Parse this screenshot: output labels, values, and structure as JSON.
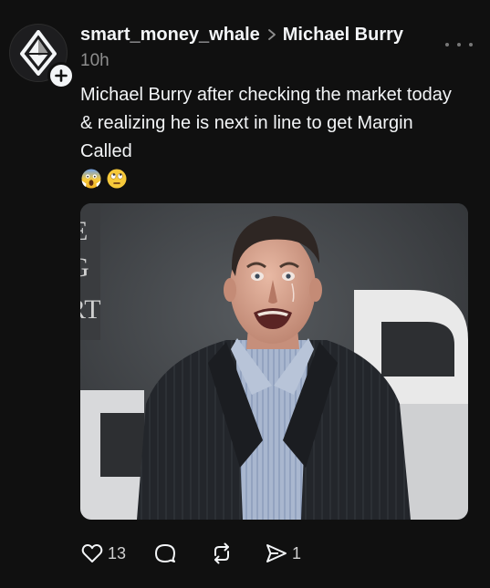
{
  "post": {
    "author": "smart_money_whale",
    "topic": "Michael Burry",
    "time": "10h",
    "caption": "Michael Burry after checking the market today & realizing he is next in line to get Margin Called",
    "emojis": [
      "face-screaming-in-fear-emoji",
      "face-with-rolling-eyes-emoji"
    ]
  },
  "actions": {
    "likes": "13",
    "reposts": "",
    "shares": "1"
  },
  "icons": {
    "avatar": "diamond-logo-icon",
    "follow": "plus-icon",
    "separator": "chevron-right-icon",
    "more": "more-horizontal-icon",
    "like": "heart-icon",
    "comment": "comment-bubble-icon",
    "repost": "repost-icon",
    "share": "send-icon"
  },
  "colors": {
    "background": "#101010",
    "text": "#f3f5f7",
    "muted": "#8e8e8e"
  }
}
